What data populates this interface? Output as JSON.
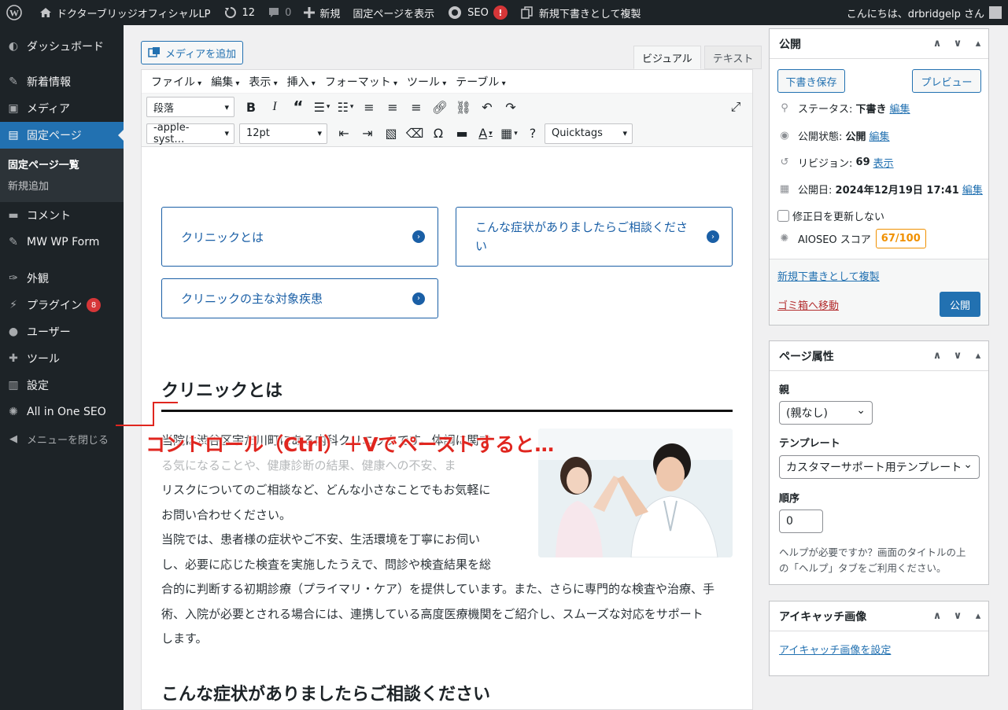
{
  "adminbar": {
    "site_name": "ドクターブリッジオフィシャルLP",
    "updates_count": "12",
    "comments_count": "0",
    "new_label": "新規",
    "view_page": "固定ページを表示",
    "seo_label": "SEO",
    "seo_badge": "!",
    "duplicate_label": "新規下書きとして複製",
    "greeting": "こんにちは、drbridgelp さん"
  },
  "sidebar": {
    "items": [
      {
        "label": "ダッシュボード",
        "icon": "dashboard-icon"
      },
      {
        "label": "新着情報",
        "icon": "pin-icon"
      },
      {
        "label": "メディア",
        "icon": "media-icon"
      },
      {
        "label": "固定ページ",
        "icon": "page-icon"
      },
      {
        "label": "コメント",
        "icon": "comment-icon"
      },
      {
        "label": "MW WP Form",
        "icon": "pin-icon"
      },
      {
        "label": "外観",
        "icon": "brush-icon"
      },
      {
        "label": "プラグイン",
        "icon": "plugin-icon",
        "badge": "8"
      },
      {
        "label": "ユーザー",
        "icon": "user-icon"
      },
      {
        "label": "ツール",
        "icon": "wrench-icon"
      },
      {
        "label": "設定",
        "icon": "settings-icon"
      },
      {
        "label": "All in One SEO",
        "icon": "aioseo-icon"
      },
      {
        "label": "メニューを閉じる",
        "icon": "collapse-icon"
      }
    ],
    "submenu": [
      "固定ページ一覧",
      "新規追加"
    ]
  },
  "editor": {
    "add_media": "メディアを追加",
    "tabs": [
      "ビジュアル",
      "テキスト"
    ],
    "menubar": [
      "ファイル",
      "編集",
      "表示",
      "挿入",
      "フォーマット",
      "ツール",
      "テーブル"
    ],
    "format_select": "段落",
    "font_select": "-apple-syst…",
    "size_select": "12pt",
    "quicktags_select": "Quicktags"
  },
  "content": {
    "nav_boxes": [
      "クリニックとは",
      "こんな症状がありましたらご相談くださ",
      "い",
      "クリニックの主な対象疾患"
    ],
    "heading1": "クリニックとは",
    "body_lines": [
      "当院は渋谷区宇だ川町にある内科クリニックです。体調に関す",
      "る気になることや、健康診断の結果、健康への不安、ま",
      "リスクについてのご相談など、どんな小さなことでもお気軽に",
      "お問い合わせください。",
      "当院では、患者様の症状やご不安、生活環境を丁寧にお伺い",
      "し、必要に応じた検査を実施したうえで、問診や検査結果を総",
      "合的に判断する初期診療（プライマリ・ケア）を提供しています。また、さらに専門的な検査や治療、手",
      "術、入院が必要とされる場合には、連携している高度医療機関をご紹介し、スムーズな対応をサポート",
      "します。"
    ],
    "heading2": "こんな症状がありましたらご相談ください"
  },
  "overlay_text": "コントロール（Ctrl）＋Vでペーストすると…",
  "publish_box": {
    "title": "公開",
    "save_draft": "下書き保存",
    "preview": "プレビュー",
    "status_label": "ステータス:",
    "status_value": "下書き",
    "visibility_label": "公開状態:",
    "visibility_value": "公開",
    "revisions_label": "リビジョン:",
    "revisions_value": "69",
    "revisions_link": "表示",
    "date_label": "公開日:",
    "date_value": "2024年12月19日 17:41",
    "edit_link": "編集",
    "modified_checkbox": "修正日を更新しない",
    "aioseo_label": "AIOSEO スコア",
    "aioseo_score": "67/100",
    "duplicate_link": "新規下書きとして複製",
    "trash_link": "ゴミ箱へ移動",
    "publish_button": "公開"
  },
  "page_attributes": {
    "title": "ページ属性",
    "parent_label": "親",
    "parent_value": "(親なし)",
    "template_label": "テンプレート",
    "template_value": "カスタマーサポート用テンプレート",
    "order_label": "順序",
    "order_value": "0",
    "help_text_1": "ヘルプが必要ですか？画面のタイトルの上",
    "help_text_2": "の「ヘルプ」タブをご利用ください。"
  },
  "featured_image": {
    "title": "アイキャッチ画像",
    "set_link": "アイキャッチ画像を設定"
  },
  "colors": {
    "admin_dark": "#1d2327",
    "accent": "#2271b1",
    "nav_blue": "#1a5fa6",
    "overlay_red": "#e0261f",
    "score_orange": "#f09000"
  }
}
